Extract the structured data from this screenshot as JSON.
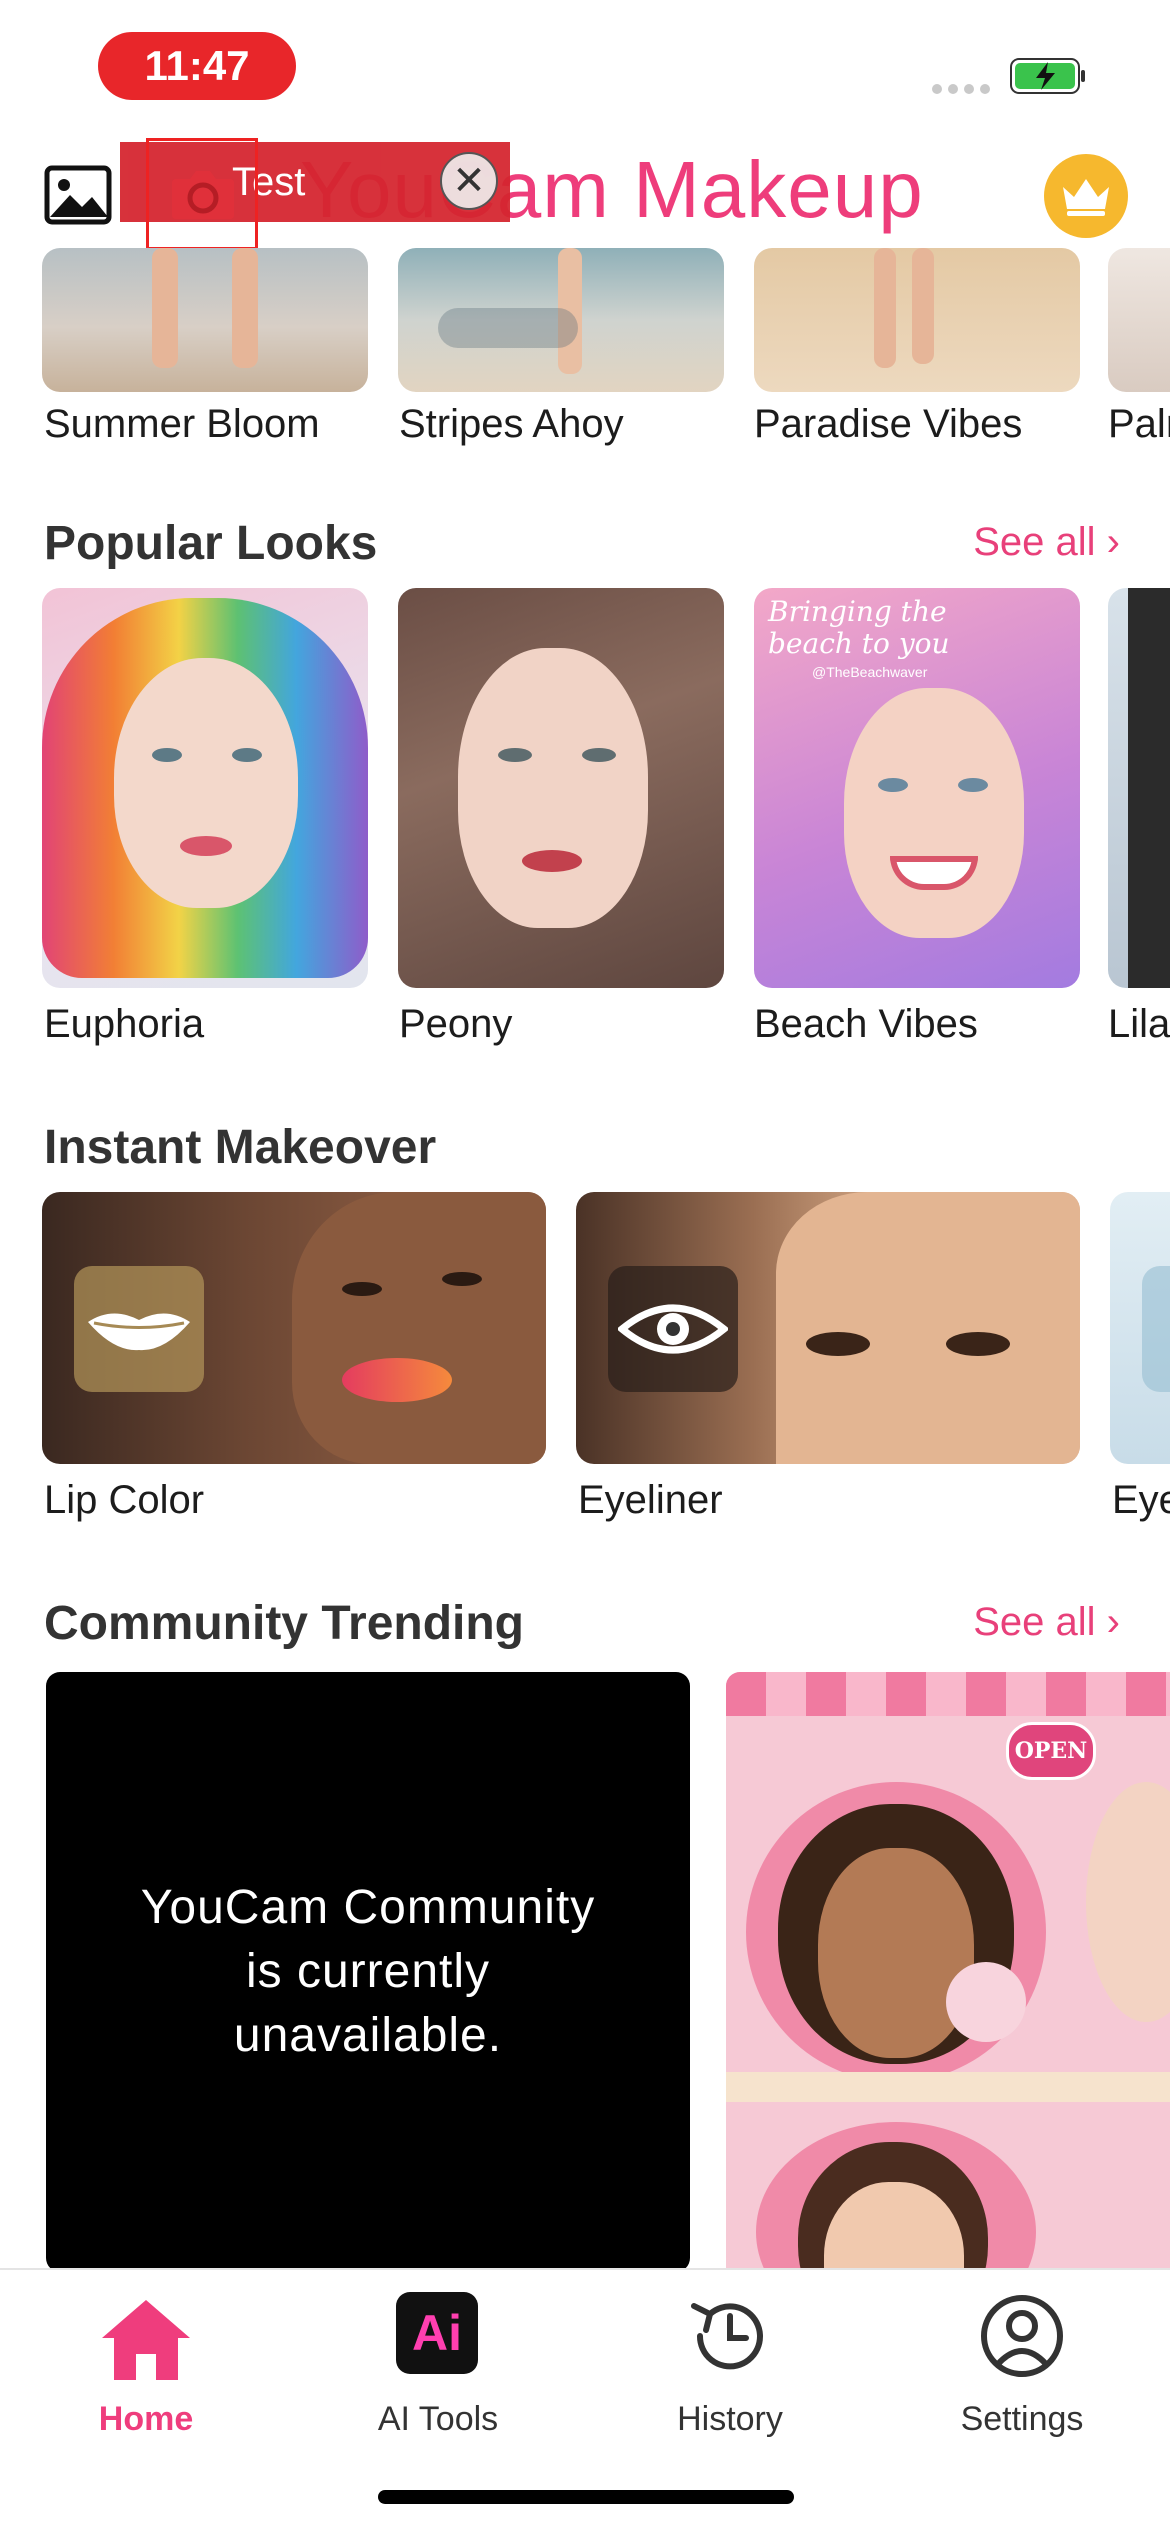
{
  "status_bar": {
    "time": "11:47"
  },
  "header": {
    "logo_text": "YouCam Makeup",
    "test_label": "Test",
    "close_glyph": "✕"
  },
  "top_row": {
    "items": [
      {
        "label": "Summer Bloom"
      },
      {
        "label": "Stripes Ahoy"
      },
      {
        "label": "Paradise Vibes"
      },
      {
        "label": "Palr"
      }
    ]
  },
  "popular_looks": {
    "title": "Popular Looks",
    "see_all": "See all ›",
    "items": [
      {
        "label": "Euphoria"
      },
      {
        "label": "Peony"
      },
      {
        "label": "Beach Vibes",
        "overlay_text": "Bringing the beach to you",
        "handle": "@TheBeachwaver"
      },
      {
        "label": "Lila"
      }
    ]
  },
  "instant_makeover": {
    "title": "Instant Makeover",
    "items": [
      {
        "label": "Lip Color",
        "icon": "lips-icon"
      },
      {
        "label": "Eyeliner",
        "icon": "eye-icon"
      },
      {
        "label": "Eye"
      }
    ]
  },
  "community": {
    "title": "Community Trending",
    "see_all": "See all ›",
    "unavailable_line1": "YouCam Community",
    "unavailable_line2": "is currently",
    "unavailable_line3": "unavailable.",
    "open_sign": "OPEN"
  },
  "tabbar": {
    "tabs": [
      {
        "label": "Home",
        "icon": "home-icon",
        "active": true
      },
      {
        "label": "AI Tools",
        "icon": "ai-tools-icon",
        "glyph": "Ai"
      },
      {
        "label": "History",
        "icon": "history-icon"
      },
      {
        "label": "Settings",
        "icon": "settings-icon"
      }
    ]
  },
  "colors": {
    "accent": "#ee3d7b",
    "status_pill": "#e8262a",
    "crown_bg": "#f6b82e"
  }
}
